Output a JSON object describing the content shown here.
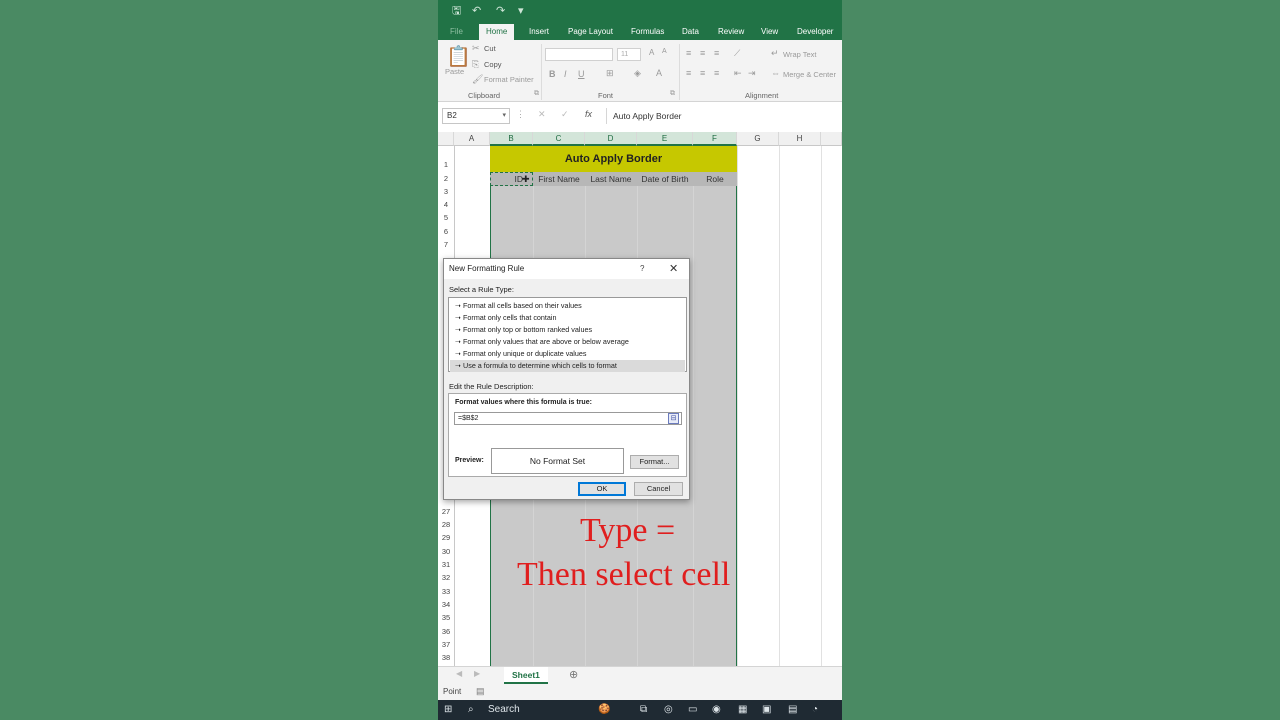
{
  "ribbon": {
    "tabs": [
      "File",
      "Home",
      "Insert",
      "Page Layout",
      "Formulas",
      "Data",
      "Review",
      "View",
      "Developer"
    ],
    "active_tab": "Home",
    "clipboard": {
      "paste": "Paste",
      "cut": "Cut",
      "copy": "Copy",
      "format_painter": "Format Painter",
      "group": "Clipboard"
    },
    "font": {
      "font_size": "11",
      "group": "Font",
      "bold": "B",
      "italic": "I",
      "underline": "U"
    },
    "alignment": {
      "wrap_text": "Wrap Text",
      "merge_center": "Merge & Center",
      "group": "Alignment"
    }
  },
  "formula_bar": {
    "name_box": "B2",
    "fx": "fx",
    "value": "Auto Apply Border"
  },
  "grid": {
    "columns": [
      "A",
      "B",
      "C",
      "D",
      "E",
      "F",
      "G",
      "H"
    ],
    "rows_top": [
      "1",
      "2",
      "3",
      "4",
      "5",
      "6",
      "7"
    ],
    "rows_bottom": [
      "27",
      "28",
      "29",
      "30",
      "31",
      "32",
      "33",
      "34",
      "35",
      "36",
      "37",
      "38"
    ],
    "title": "Auto Apply Border",
    "headers": [
      "ID",
      "First Name",
      "Last Name",
      "Date of Birth",
      "Role"
    ]
  },
  "dialog": {
    "title": "New Formatting Rule",
    "help": "?",
    "select_label": "Select a Rule Type:",
    "rule_types": [
      "Format all cells based on their values",
      "Format only cells that contain",
      "Format only top or bottom ranked values",
      "Format only values that are above or below average",
      "Format only unique or duplicate values",
      "Use a formula to determine which cells to format"
    ],
    "selected_rule_index": 5,
    "edit_label": "Edit the Rule Description:",
    "formula_label": "Format values where this formula is true:",
    "formula_value": "=$B$2",
    "preview_label": "Preview:",
    "preview_text": "No Format Set",
    "format_button": "Format...",
    "ok_button": "OK",
    "cancel_button": "Cancel"
  },
  "sheets": {
    "active": "Sheet1"
  },
  "status": {
    "mode": "Point"
  },
  "taskbar": {
    "search": "Search"
  },
  "overlay": {
    "line1": "Type  =",
    "line2": "Then select cell"
  },
  "colors": {
    "excel_green": "#217346",
    "title_fill": "#c6c800",
    "overlay_red": "#e01e1e"
  }
}
